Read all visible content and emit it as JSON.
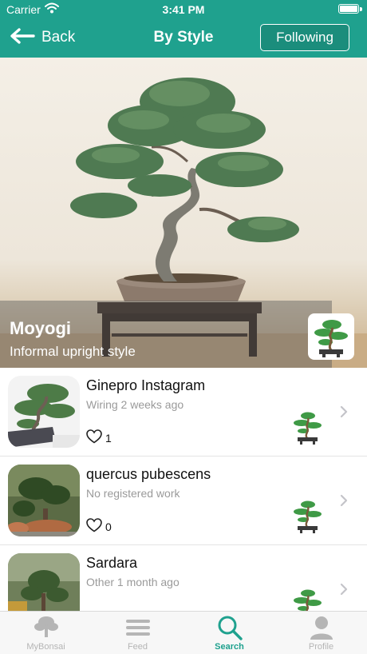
{
  "status_bar": {
    "carrier": "Carrier",
    "time": "3:41 PM"
  },
  "nav": {
    "back_label": "Back",
    "title": "By Style",
    "follow_label": "Following"
  },
  "hero": {
    "title": "Moyogi",
    "subtitle": "Informal upright style"
  },
  "items": [
    {
      "name": "Ginepro Instagram",
      "subtitle": "Wiring 2 weeks ago",
      "likes": "1"
    },
    {
      "name": "quercus pubescens",
      "subtitle": "No registered work",
      "likes": "0"
    },
    {
      "name": "Sardara",
      "subtitle": "Other 1 month ago",
      "likes": ""
    }
  ],
  "tabs": [
    {
      "label": "MyBonsai",
      "icon": "tree-icon",
      "active": false
    },
    {
      "label": "Feed",
      "icon": "menu-icon",
      "active": false
    },
    {
      "label": "Search",
      "icon": "search-icon",
      "active": true
    },
    {
      "label": "Profile",
      "icon": "person-icon",
      "active": false
    }
  ],
  "colors": {
    "accent": "#1fa18e",
    "muted_text": "#9a9a9a",
    "inactive_tab": "#b5b5b5"
  }
}
